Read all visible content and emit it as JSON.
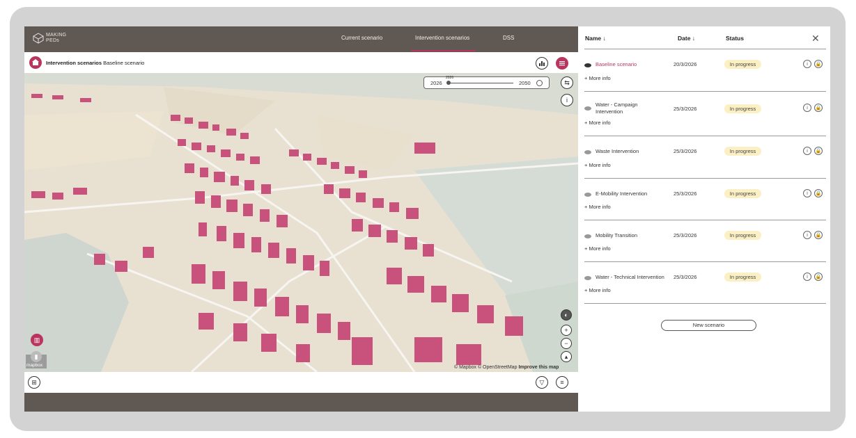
{
  "app": {
    "logo_line1": "MAKING",
    "logo_line2": "PEDs",
    "nav": [
      "Current scenario",
      "Intervention scenarios",
      "DSS"
    ],
    "active_nav": "Intervention scenarios",
    "accent": "#b9355e",
    "bar_color": "#5f5853"
  },
  "subbar": {
    "title_bold": "Intervention scenarios",
    "title_rest": "Baseline scenario"
  },
  "timeline": {
    "start": "2026",
    "current": "2026",
    "end": "2050"
  },
  "map": {
    "attribution_text": "© Mapbox © OpenStreetMap",
    "improve_link": "Improve this map",
    "mapbox_logo": "mapbox",
    "building_color": "#c9527c"
  },
  "panel": {
    "col_name": "Name ↓",
    "col_date": "Date ↓",
    "col_status": "Status",
    "more_info": "+ More info",
    "new_scenario": "New scenario",
    "rows": [
      {
        "name": "Baseline scenario",
        "date": "20/3/2026",
        "status": "In progress"
      },
      {
        "name": "Water - Campaign Intervention",
        "date": "25/3/2026",
        "status": "In progress"
      },
      {
        "name": "Waste Intervention",
        "date": "25/3/2026",
        "status": "In progress"
      },
      {
        "name": "E-Mobility Intervention",
        "date": "25/3/2026",
        "status": "In progress"
      },
      {
        "name": "Mobility Transition",
        "date": "25/3/2026",
        "status": "In progress"
      },
      {
        "name": "Water - Technical Intervention",
        "date": "25/3/2026",
        "status": "In progress"
      }
    ]
  }
}
